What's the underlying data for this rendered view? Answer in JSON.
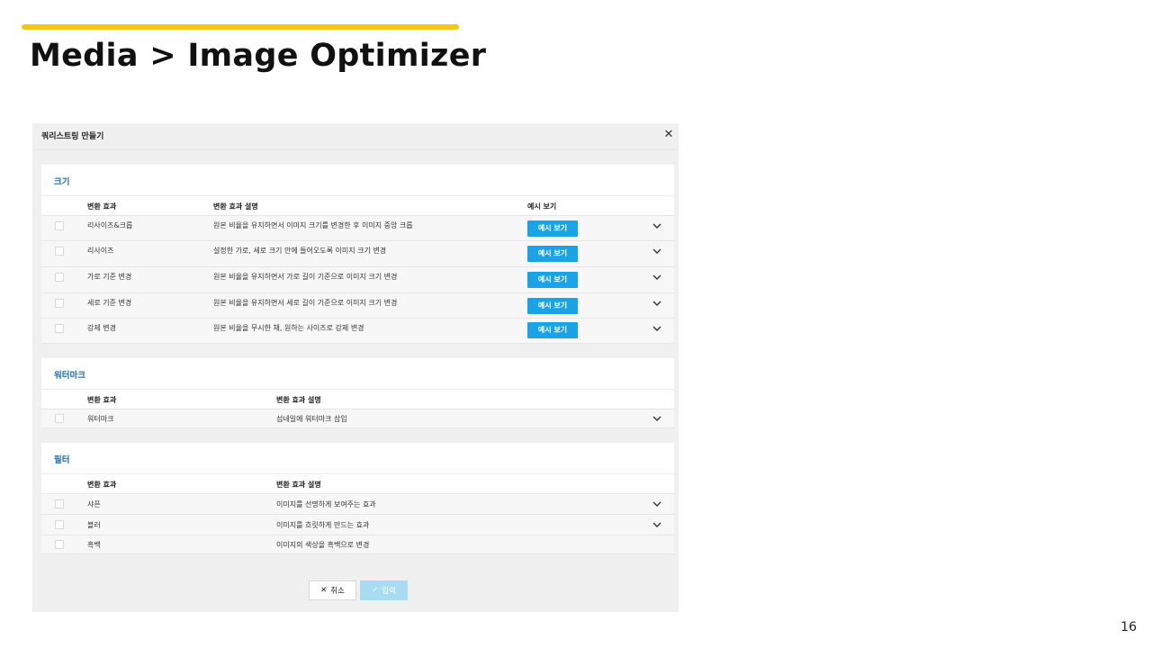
{
  "slide": {
    "title": "Media  >  Image Optimizer",
    "page_number": "16"
  },
  "modal": {
    "title": "쿼리스트링 만들기",
    "close_icon": "close-icon",
    "sections": {
      "size": {
        "title": "크기",
        "headers": {
          "effect": "변환 효과",
          "description": "변환 효과 설명",
          "preview": "예시 보기"
        },
        "rows": [
          {
            "effect": "리사이즈&크롭",
            "description": "원본 비율을 유지하면서 이미지 크기를 변경한 후 이미지 중앙 크롭",
            "button": "예시 보기"
          },
          {
            "effect": "리사이즈",
            "description": "설정한 가로, 세로 크기 안에 들어오도록 이미지 크기 변경",
            "button": "예시 보기"
          },
          {
            "effect": "가로 기준 변경",
            "description": "원본 비율을 유지하면서 가로 길이 기준으로 이미지 크기 변경",
            "button": "예시 보기"
          },
          {
            "effect": "세로 기준 변경",
            "description": "원본 비율을 유지하면서 세로 길이 기준으로 이미지 크기 변경",
            "button": "예시 보기"
          },
          {
            "effect": "강제 변경",
            "description": "원본 비율을 무시한 채, 원하는 사이즈로 강제 변경",
            "button": "예시 보기"
          }
        ]
      },
      "watermark": {
        "title": "워터마크",
        "headers": {
          "effect": "변환 효과",
          "description": "변환 효과 설명"
        },
        "rows": [
          {
            "effect": "워터마크",
            "description": "섬네일에 워터마크 삽입"
          }
        ]
      },
      "filter": {
        "title": "필터",
        "headers": {
          "effect": "변환 효과",
          "description": "변환 효과 설명"
        },
        "rows": [
          {
            "effect": "샤픈",
            "description": "이미지를 선명하게 보여주는 효과"
          },
          {
            "effect": "블러",
            "description": "이미지를 흐릿하게 만드는 효과"
          },
          {
            "effect": "흑백",
            "description": "이미지의 색상을 흑백으로 변경"
          }
        ]
      }
    },
    "footer": {
      "cancel_label": "취소",
      "submit_label": "입력"
    }
  },
  "colors": {
    "accent": "#f5c518",
    "section_title": "#1e6fb0",
    "preview_button": "#1aa3e6",
    "submit_disabled": "#a9dcf3"
  }
}
